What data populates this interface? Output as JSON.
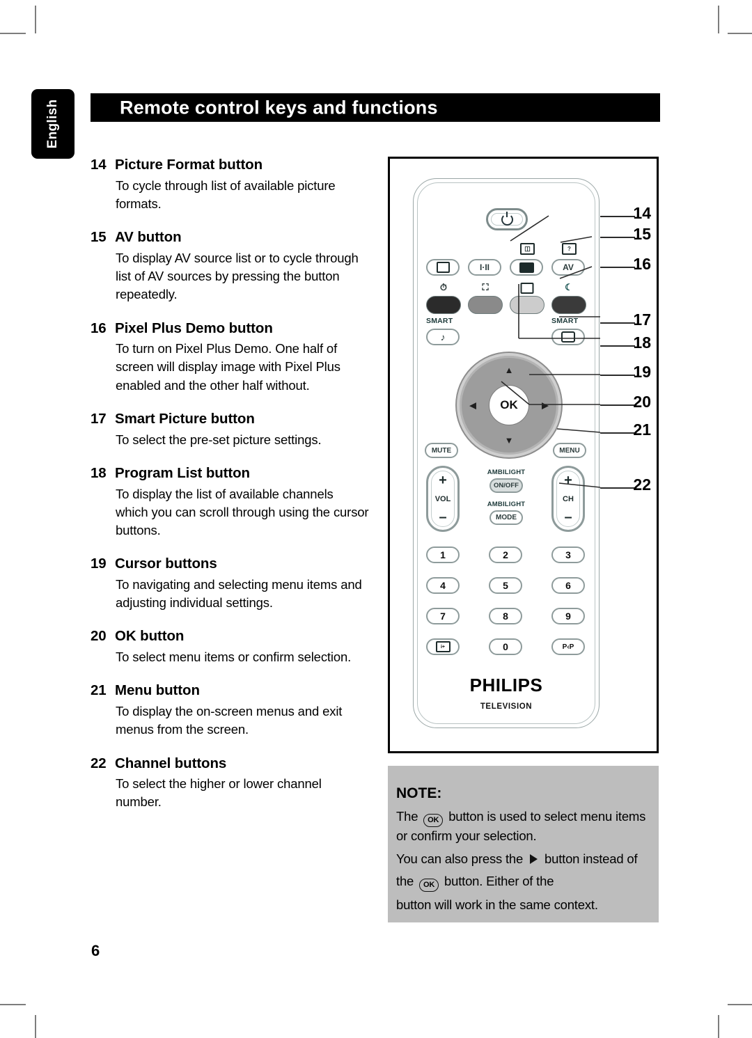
{
  "page": {
    "language_tab": "English",
    "header_title": "Remote control keys and functions",
    "page_number": "6"
  },
  "entries": [
    {
      "num": "14",
      "title": "Picture Format button",
      "body": "To cycle through list of available picture formats."
    },
    {
      "num": "15",
      "title": "AV button",
      "body": "To display AV source list or to cycle through list of AV sources by pressing the button repeatedly."
    },
    {
      "num": "16",
      "title": "Pixel Plus Demo button",
      "body": "To turn on Pixel Plus Demo. One half of screen will display image with Pixel Plus enabled and the other half without."
    },
    {
      "num": "17",
      "title": "Smart Picture button",
      "body": "To select the pre-set picture settings."
    },
    {
      "num": "18",
      "title": "Program List button",
      "body": "To display the list of available channels which you can scroll through using the cursor buttons."
    },
    {
      "num": "19",
      "title": "Cursor buttons",
      "body": "To navigating and selecting menu items and adjusting individual settings."
    },
    {
      "num": "20",
      "title": "OK button",
      "body": "To select menu items or confirm selection."
    },
    {
      "num": "21",
      "title": "Menu button",
      "body": "To display the on-screen menus and exit menus from the screen."
    },
    {
      "num": "22",
      "title": "Channel buttons",
      "body": "To select the higher or lower channel number."
    }
  ],
  "remote": {
    "power_label": "power-icon",
    "top_keys": [
      {
        "label": "teletext-icon",
        "icon": "≡"
      },
      {
        "label": "I·II",
        "icon": ""
      },
      {
        "label": "picture-format-icon",
        "icon": ""
      },
      {
        "label": "AV",
        "icon": ""
      }
    ],
    "dual_sound_label": "I·II",
    "av_label": "AV",
    "mini_icons": {
      "format_top": "⊕",
      "help_top": "?"
    },
    "color_buttons": [
      {
        "name": "red",
        "color": "#2b2b2b"
      },
      {
        "name": "green",
        "color": "#8a8a8a"
      },
      {
        "name": "yellow",
        "color": "#cccccc"
      },
      {
        "name": "blue",
        "color": "#3a3a3a"
      }
    ],
    "smart_label_left": "SMART",
    "smart_label_right": "SMART",
    "smart_sound_icon": "♪",
    "smart_picture_icon": "⬜",
    "cursor": {
      "up": "▲",
      "down": "▼",
      "left": "◀",
      "right": "▶",
      "ok": "OK"
    },
    "mute_label": "MUTE",
    "menu_label": "MENU",
    "vol": {
      "plus": "+",
      "minus": "–",
      "label": "VOL"
    },
    "ch": {
      "plus": "+",
      "minus": "–",
      "label": "CH"
    },
    "ambilight": {
      "caption_1": "AMBILIGHT",
      "button_1": "ON/OFF",
      "caption_2": "AMBILIGHT",
      "button_2": "MODE"
    },
    "numeric_keys": [
      "1",
      "2",
      "3",
      "4",
      "5",
      "6",
      "7",
      "8",
      "9",
      "0"
    ],
    "info_key": "i+",
    "pip_key": "P‹P",
    "brand": "PHILIPS",
    "brand_sub": "TELEVISION",
    "callouts": [
      "14",
      "15",
      "16",
      "17",
      "18",
      "19",
      "20",
      "21",
      "22"
    ]
  },
  "note": {
    "title": "NOTE:",
    "par1_a": "The",
    "par1_chip": "OK",
    "par1_b": "button is used to select menu items or confirm your selection.",
    "par2_a": "You can also press the",
    "par2_b": "button instead of",
    "par3_a": "the",
    "par3_chip": "OK",
    "par3_b": "button. Either of the",
    "par4": "button will work in the same context."
  }
}
